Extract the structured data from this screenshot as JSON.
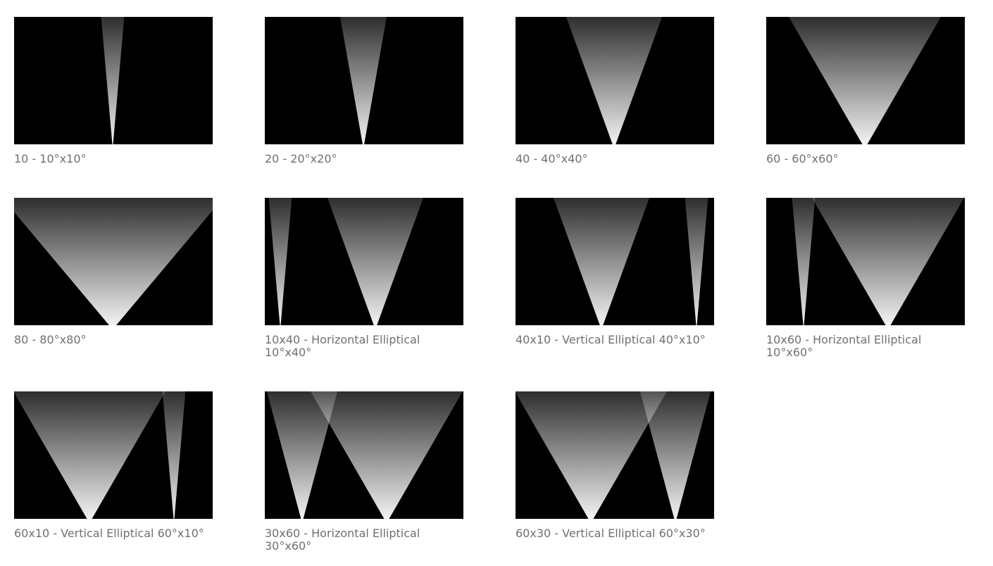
{
  "colors": {
    "background": "#ffffff",
    "panel": "#000000",
    "caption": "#707070",
    "beam_light": "#ffffff",
    "fixture": "#6e6e6e"
  },
  "items": [
    {
      "caption": "10 - 10°x10°",
      "beams": [
        {
          "angle_deg": 10,
          "fixture": "round"
        }
      ]
    },
    {
      "caption": "20 - 20°x20°",
      "beams": [
        {
          "angle_deg": 20,
          "fixture": "round"
        }
      ]
    },
    {
      "caption": "40 - 40°x40°",
      "beams": [
        {
          "angle_deg": 40,
          "fixture": "round"
        }
      ]
    },
    {
      "caption": "60 - 60°x60°",
      "beams": [
        {
          "angle_deg": 60,
          "fixture": "round"
        }
      ]
    },
    {
      "caption": "80 - 80°x80°",
      "beams": [
        {
          "angle_deg": 80,
          "fixture": "round"
        }
      ]
    },
    {
      "caption": "10x40 - Horizontal Elliptical 10°x40°",
      "beams": [
        {
          "angle_deg": 10,
          "fixture": "bar"
        },
        {
          "angle_deg": 40,
          "fixture": "round"
        }
      ]
    },
    {
      "caption": "40x10 - Vertical Elliptical 40°x10°",
      "beams": [
        {
          "angle_deg": 40,
          "fixture": "bar"
        },
        {
          "angle_deg": 10,
          "fixture": "round"
        }
      ]
    },
    {
      "caption": "10x60 - Horizontal Elliptical 10°x60°",
      "beams": [
        {
          "angle_deg": 10,
          "fixture": "bar"
        },
        {
          "angle_deg": 60,
          "fixture": "round"
        }
      ]
    },
    {
      "caption": "60x10 - Vertical Elliptical 60°x10°",
      "beams": [
        {
          "angle_deg": 60,
          "fixture": "bar"
        },
        {
          "angle_deg": 10,
          "fixture": "round"
        }
      ]
    },
    {
      "caption": "30x60 - Horizontal Elliptical 30°x60°",
      "beams": [
        {
          "angle_deg": 30,
          "fixture": "bar"
        },
        {
          "angle_deg": 60,
          "fixture": "round"
        }
      ]
    },
    {
      "caption": "60x30 - Vertical Elliptical 60°x30°",
      "beams": [
        {
          "angle_deg": 60,
          "fixture": "bar"
        },
        {
          "angle_deg": 30,
          "fixture": "round"
        }
      ]
    }
  ]
}
